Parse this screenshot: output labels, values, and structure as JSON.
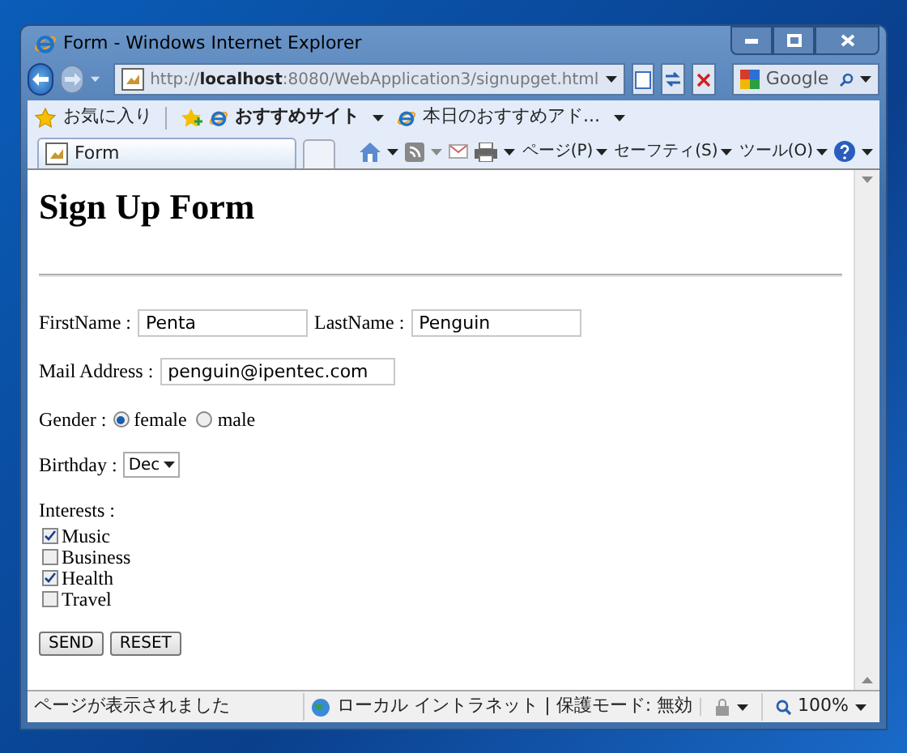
{
  "window": {
    "title": "Form - Windows Internet Explorer"
  },
  "address_bar": {
    "url": "http://**localhost**:8080/WebApplication3/signupget.html"
  },
  "search": {
    "placeholder": "Google"
  },
  "favorites_bar": {
    "favorites": "お気に入り",
    "links": [
      {
        "label": "おすすめサイト",
        "bold": true
      },
      {
        "label": "本日のおすすめアド...",
        "bold": false
      }
    ]
  },
  "tab": {
    "label": "Form"
  },
  "command_bar": {
    "menus": [
      "ページ(P)",
      "セーフティ(S)",
      "ツール(O)"
    ]
  },
  "page": {
    "heading": "Sign Up Form",
    "first_name": {
      "label": "FirstName :",
      "value": "Penta"
    },
    "last_name": {
      "label": "LastName :",
      "value": "Penguin"
    },
    "mail": {
      "label": "Mail Address :",
      "value": "penguin@ipentec.com"
    },
    "gender": {
      "label": "Gender :",
      "options": [
        {
          "label": "female",
          "selected": true
        },
        {
          "label": "male",
          "selected": false
        }
      ]
    },
    "birthday": {
      "label": "Birthday :",
      "value": "Dec"
    },
    "interests": {
      "label": "Interests :",
      "items": [
        {
          "label": "Music",
          "checked": true
        },
        {
          "label": "Business",
          "checked": false
        },
        {
          "label": "Health",
          "checked": true
        },
        {
          "label": "Travel",
          "checked": false
        }
      ]
    },
    "buttons": [
      "SEND",
      "RESET"
    ]
  },
  "status_bar": {
    "text": "ページが表示されました",
    "zone": "ローカル イントラネット | 保護モード: 無効",
    "zoom": "100%"
  }
}
